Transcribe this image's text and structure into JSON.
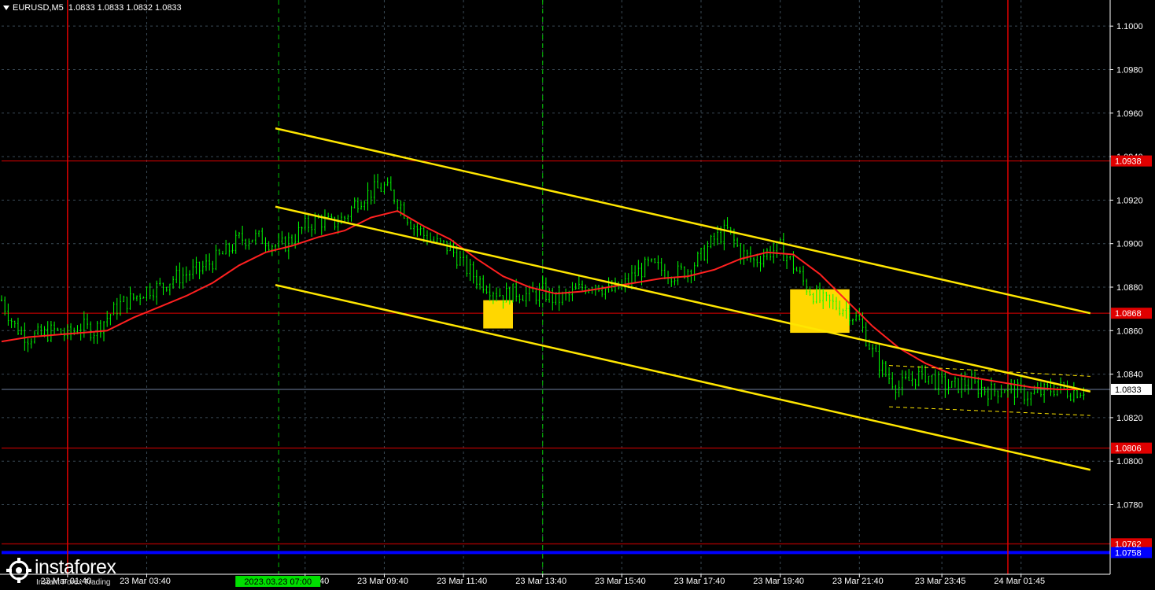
{
  "header": {
    "symbol": "EURUSD,M5",
    "ohlc": "1.0833 1.0833 1.0832 1.0833"
  },
  "logo": {
    "name": "instaforex",
    "tagline": "Instant Forex Trading"
  },
  "colors": {
    "background": "#000000",
    "grid": "#3a4a56",
    "candle": "#00ff00",
    "moving_average": "#ff2020",
    "channel": "#ffe600",
    "level": "#e00000",
    "support": "#0000ff",
    "current_price_line": "#7080a0",
    "signal_box": "#ffd700",
    "session_marker": "#00c000",
    "axis_text": "#ffffff"
  },
  "chart_data": {
    "type": "candlestick",
    "title": "EURUSD,M5",
    "ylim": [
      1.0748,
      1.1012
    ],
    "y_ticks": [
      "1.1000",
      "1.0980",
      "1.0960",
      "1.0940",
      "1.0920",
      "1.0900",
      "1.0880",
      "1.0860",
      "1.0840",
      "1.0820",
      "1.0800",
      "1.0780"
    ],
    "x_ticks": [
      "23 Mar 01:40",
      "23 Mar 03:40",
      "23 Mar 07:40",
      "23 Mar 09:40",
      "23 Mar 11:40",
      "23 Mar 13:40",
      "23 Mar 15:40",
      "23 Mar 17:40",
      "23 Mar 19:40",
      "23 Mar 21:40",
      "23 Mar 23:45",
      "24 Mar 01:45"
    ],
    "x_start": "23 Mar 00:00",
    "x_end": "24 Mar 02:20",
    "x_tick_minutes": [
      100,
      220,
      460,
      580,
      700,
      820,
      940,
      1060,
      1180,
      1300,
      1425,
      1545
    ],
    "highlight_label": "2023.03.23 07:00",
    "highlight_minutes": 420,
    "close_path": [
      [
        0,
        1.0874
      ],
      [
        20,
        1.0862
      ],
      [
        40,
        1.0857
      ],
      [
        60,
        1.0858
      ],
      [
        80,
        1.086
      ],
      [
        100,
        1.0858
      ],
      [
        120,
        1.0862
      ],
      [
        140,
        1.086
      ],
      [
        160,
        1.0866
      ],
      [
        180,
        1.0872
      ],
      [
        200,
        1.0875
      ],
      [
        220,
        1.0879
      ],
      [
        240,
        1.088
      ],
      [
        260,
        1.0884
      ],
      [
        280,
        1.0886
      ],
      [
        300,
        1.0888
      ],
      [
        320,
        1.0892
      ],
      [
        340,
        1.0896
      ],
      [
        360,
        1.0902
      ],
      [
        380,
        1.0903
      ],
      [
        400,
        1.0902
      ],
      [
        420,
        1.0898
      ],
      [
        440,
        1.0902
      ],
      [
        460,
        1.0908
      ],
      [
        480,
        1.0911
      ],
      [
        500,
        1.0909
      ],
      [
        520,
        1.0912
      ],
      [
        540,
        1.092
      ],
      [
        560,
        1.0924
      ],
      [
        580,
        1.0926
      ],
      [
        600,
        1.092
      ],
      [
        620,
        1.091
      ],
      [
        640,
        1.0904
      ],
      [
        660,
        1.09
      ],
      [
        680,
        1.0898
      ],
      [
        700,
        1.089
      ],
      [
        720,
        1.0884
      ],
      [
        740,
        1.088
      ],
      [
        760,
        1.0876
      ],
      [
        780,
        1.0878
      ],
      [
        800,
        1.0876
      ],
      [
        820,
        1.0878
      ],
      [
        840,
        1.0874
      ],
      [
        860,
        1.0876
      ],
      [
        880,
        1.088
      ],
      [
        900,
        1.0882
      ],
      [
        920,
        1.0878
      ],
      [
        940,
        1.088
      ],
      [
        960,
        1.0886
      ],
      [
        980,
        1.089
      ],
      [
        1000,
        1.0888
      ],
      [
        1020,
        1.0886
      ],
      [
        1040,
        1.0888
      ],
      [
        1060,
        1.0894
      ],
      [
        1080,
        1.0902
      ],
      [
        1100,
        1.0906
      ],
      [
        1120,
        1.0896
      ],
      [
        1140,
        1.0892
      ],
      [
        1160,
        1.0896
      ],
      [
        1180,
        1.0898
      ],
      [
        1200,
        1.089
      ],
      [
        1220,
        1.088
      ],
      [
        1240,
        1.0874
      ],
      [
        1260,
        1.0872
      ],
      [
        1280,
        1.087
      ],
      [
        1300,
        1.0864
      ],
      [
        1320,
        1.085
      ],
      [
        1340,
        1.084
      ],
      [
        1360,
        1.0834
      ],
      [
        1380,
        1.0838
      ],
      [
        1400,
        1.084
      ],
      [
        1420,
        1.0836
      ],
      [
        1440,
        1.0834
      ],
      [
        1460,
        1.0836
      ],
      [
        1480,
        1.0834
      ],
      [
        1500,
        1.0832
      ],
      [
        1520,
        1.0834
      ],
      [
        1540,
        1.0832
      ],
      [
        1560,
        1.083
      ],
      [
        1580,
        1.0832
      ],
      [
        1600,
        1.0834
      ],
      [
        1620,
        1.0832
      ],
      [
        1640,
        1.0833
      ]
    ],
    "moving_average": [
      [
        0,
        1.0855
      ],
      [
        40,
        1.0857
      ],
      [
        80,
        1.0858
      ],
      [
        120,
        1.0859
      ],
      [
        160,
        1.086
      ],
      [
        200,
        1.0866
      ],
      [
        240,
        1.0871
      ],
      [
        280,
        1.0876
      ],
      [
        320,
        1.0882
      ],
      [
        360,
        1.089
      ],
      [
        400,
        1.0896
      ],
      [
        440,
        1.0899
      ],
      [
        480,
        1.0903
      ],
      [
        520,
        1.0906
      ],
      [
        560,
        1.0912
      ],
      [
        600,
        1.0915
      ],
      [
        640,
        1.0908
      ],
      [
        680,
        1.0902
      ],
      [
        720,
        1.0893
      ],
      [
        760,
        1.0885
      ],
      [
        800,
        1.088
      ],
      [
        840,
        1.0877
      ],
      [
        880,
        1.0878
      ],
      [
        920,
        1.088
      ],
      [
        960,
        1.0882
      ],
      [
        1000,
        1.0884
      ],
      [
        1040,
        1.0885
      ],
      [
        1080,
        1.0888
      ],
      [
        1120,
        1.0893
      ],
      [
        1160,
        1.0896
      ],
      [
        1200,
        1.0895
      ],
      [
        1240,
        1.0886
      ],
      [
        1280,
        1.0874
      ],
      [
        1320,
        1.0862
      ],
      [
        1360,
        1.0852
      ],
      [
        1400,
        1.0845
      ],
      [
        1440,
        1.084
      ],
      [
        1480,
        1.0838
      ],
      [
        1520,
        1.0836
      ],
      [
        1560,
        1.0834
      ],
      [
        1600,
        1.0833
      ],
      [
        1640,
        1.0833
      ]
    ],
    "channel_lines": [
      {
        "from": [
          415,
          1.0953
        ],
        "to": [
          1650,
          1.0868
        ]
      },
      {
        "from": [
          415,
          1.0917
        ],
        "to": [
          1650,
          1.0832
        ]
      },
      {
        "from": [
          415,
          1.0881
        ],
        "to": [
          1650,
          1.0796
        ]
      }
    ],
    "regression_lines": [
      {
        "from": [
          1345,
          1.0844
        ],
        "to": [
          1650,
          1.0839
        ]
      },
      {
        "from": [
          1345,
          1.0825
        ],
        "to": [
          1650,
          1.0821
        ]
      }
    ],
    "levels": [
      {
        "value": 1.0938,
        "label": "1.0938",
        "color": "#e00000"
      },
      {
        "value": 1.0868,
        "label": "1.0868",
        "color": "#e00000"
      },
      {
        "value": 1.0806,
        "label": "1.0806",
        "color": "#e00000"
      },
      {
        "value": 1.0762,
        "label": "1.0762",
        "color": "#e00000"
      },
      {
        "value": 1.0758,
        "label": "1.0758",
        "color": "#0000ff"
      }
    ],
    "current_price": {
      "value": 1.0833,
      "label": "1.0833"
    },
    "session_verticals_red": [
      100,
      1525
    ],
    "session_verticals_green": [
      420,
      820
    ],
    "signal_boxes": [
      {
        "x0": 730,
        "x1": 775,
        "y0": 1.0861,
        "y1": 1.0874
      },
      {
        "x0": 1195,
        "x1": 1285,
        "y0": 1.0859,
        "y1": 1.0879
      }
    ]
  }
}
